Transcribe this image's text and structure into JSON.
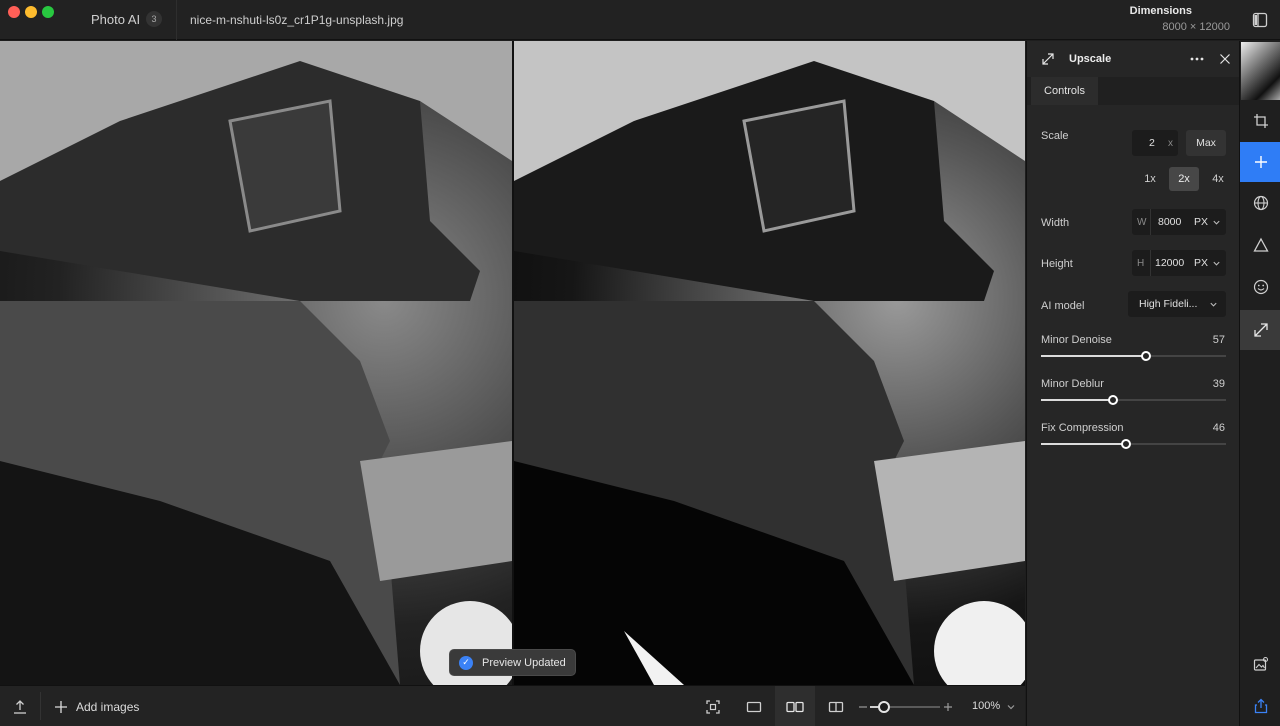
{
  "titlebar": {
    "app_name": "Photo AI",
    "badge_count": "3",
    "file_name": "nice-m-nshuti-ls0z_cr1P1g-unsplash.jpg",
    "dimensions_label": "Dimensions",
    "dimensions_value": "8000 × 12000"
  },
  "toast": {
    "text": "Preview Updated"
  },
  "bottombar": {
    "add_images": "Add images",
    "zoom_value": "100%",
    "zoom_fraction": 0.2
  },
  "panel": {
    "title": "Upscale",
    "tabs": [
      {
        "label": "Controls"
      }
    ],
    "scale": {
      "label": "Scale",
      "value": "2",
      "unit": "x",
      "max_label": "Max",
      "presets": [
        "1x",
        "2x",
        "4x"
      ],
      "selected": "2x"
    },
    "width": {
      "label": "Width",
      "prefix": "W",
      "value": "8000",
      "unit": "PX"
    },
    "height": {
      "label": "Height",
      "prefix": "H",
      "value": "12000",
      "unit": "PX"
    },
    "ai_model": {
      "label": "AI model",
      "value": "High Fideli..."
    },
    "sliders": [
      {
        "label": "Minor Denoise",
        "value": "57",
        "fraction": 0.57
      },
      {
        "label": "Minor Deblur",
        "value": "39",
        "fraction": 0.39
      },
      {
        "label": "Fix Compression",
        "value": "46",
        "fraction": 0.46
      }
    ]
  },
  "colors": {
    "accent": "#2f7df6",
    "panel_bg": "#262626",
    "app_bg": "#1e1e1e"
  }
}
